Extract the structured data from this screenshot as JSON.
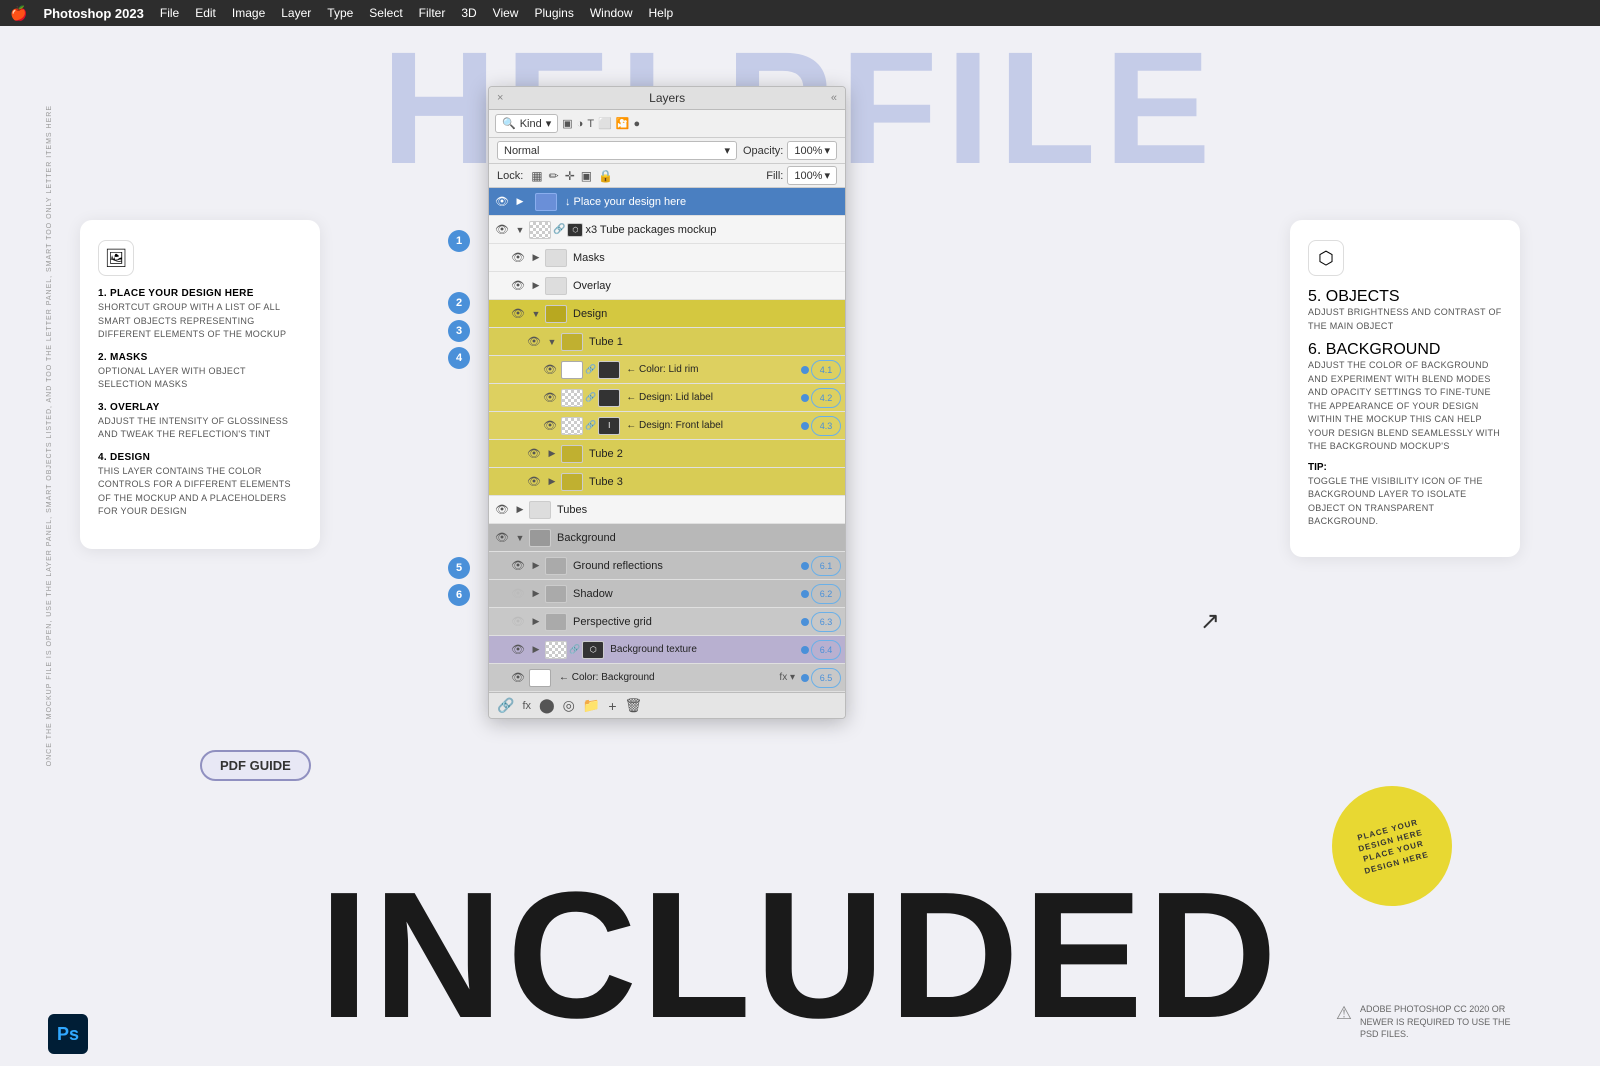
{
  "app": {
    "name": "Photoshop 2023",
    "apple_icon": "🍎",
    "menus": [
      "File",
      "Edit",
      "Image",
      "Layer",
      "Type",
      "Select",
      "Filter",
      "3D",
      "View",
      "Plugins",
      "Window",
      "Help"
    ]
  },
  "bg_text": {
    "top": "HELPFILE",
    "bottom": "INCLUDED"
  },
  "left_card": {
    "icon": "🖼",
    "sections": [
      {
        "num": "1.",
        "title": "PLACE YOUR DESIGN HERE",
        "desc": "SHORTCUT GROUP WITH A LIST OF ALL SMART OBJECTS REPRESENTING DIFFERENT ELEMENTS OF THE MOCKUP"
      },
      {
        "num": "2.",
        "title": "MASKS",
        "desc": "OPTIONAL LAYER WITH OBJECT SELECTION MASKS"
      },
      {
        "num": "3.",
        "title": "OVERLAY",
        "desc": "ADJUST THE INTENSITY OF GLOSSINESS AND TWEAK THE REFLECTION'S TINT"
      },
      {
        "num": "4.",
        "title": "DESIGN",
        "desc": "THIS LAYER CONTAINS THE COLOR CONTROLS FOR A DIFFERENT ELEMENTS OF THE MOCKUP AND A PLACEHOLDERS FOR YOUR DESIGN"
      }
    ]
  },
  "right_card": {
    "icon": "⬡",
    "sections": [
      {
        "num": "5.",
        "title": "OBJECTS",
        "desc": "ADJUST BRIGHTNESS AND CONTRAST OF THE MAIN OBJECT"
      },
      {
        "num": "6.",
        "title": "BACKGROUND",
        "desc": "ADJUST THE COLOR OF BACKGROUND AND EXPERIMENT WITH BLEND MODES AND OPACITY SETTINGS TO FINE-TUNE THE APPEARANCE OF YOUR DESIGN WITHIN THE MOCKUP THIS CAN HELP YOUR DESIGN BLEND SEAMLESSLY WITH THE BACKGROUND MOCKUP'S"
      },
      {
        "tip_label": "TIP:",
        "tip": "TOGGLE THE VISIBILITY ICON OF THE BACKGROUND LAYER TO ISOLATE OBJECT ON TRANSPARENT BACKGROUND."
      }
    ]
  },
  "layers_panel": {
    "title": "Layers",
    "close": "×",
    "collapse": "«",
    "filter": {
      "kind_label": "Kind",
      "icons": [
        "img",
        "adj",
        "T",
        "shape",
        "smart",
        "dot"
      ]
    },
    "blend_mode": "Normal",
    "opacity_label": "Opacity:",
    "opacity_value": "100%",
    "lock_label": "Lock:",
    "fill_label": "Fill:",
    "fill_value": "100%",
    "rows": [
      {
        "id": "r1",
        "level": 0,
        "eye": true,
        "arrow": "▶",
        "type": "folder",
        "label": "↓ Place your design here",
        "badge": "",
        "num_indicator": "1",
        "bg": "blue_header"
      },
      {
        "id": "r2",
        "level": 0,
        "eye": true,
        "arrow": "▼",
        "type": "folder",
        "thumb": "checker",
        "chain": true,
        "smart_icon": true,
        "label": "x3 Tube packages mockup",
        "badge": "",
        "num_indicator": ""
      },
      {
        "id": "r3",
        "level": 1,
        "eye": true,
        "arrow": "▶",
        "type": "folder",
        "label": "Masks",
        "badge": "",
        "num_indicator": "2"
      },
      {
        "id": "r4",
        "level": 1,
        "eye": true,
        "arrow": "▶",
        "type": "folder",
        "label": "Overlay",
        "badge": "",
        "num_indicator": "3"
      },
      {
        "id": "r5",
        "level": 1,
        "eye": true,
        "arrow": "▼",
        "type": "folder",
        "label": "Design",
        "badge": "",
        "num_indicator": "4",
        "bg": "yellow"
      },
      {
        "id": "r6",
        "level": 2,
        "eye": true,
        "arrow": "▼",
        "type": "folder",
        "label": "Tube 1",
        "badge": "",
        "bg": "yellow"
      },
      {
        "id": "r7",
        "level": 3,
        "eye": true,
        "arrow": "",
        "type": "layer",
        "thumb": "black",
        "chain": true,
        "thumb2": "black",
        "label": "← Color: Lid rim",
        "dot": true,
        "badge": "4.1",
        "bg": "yellow"
      },
      {
        "id": "r8",
        "level": 3,
        "eye": true,
        "arrow": "",
        "type": "layer",
        "thumb": "checker",
        "chain": true,
        "thumb2": "black",
        "label": "← Design: Lid label",
        "dot": true,
        "badge": "4.2",
        "bg": "yellow"
      },
      {
        "id": "r9",
        "level": 3,
        "eye": true,
        "arrow": "",
        "type": "layer",
        "thumb": "checker",
        "chain": true,
        "thumb2": "black",
        "label": "← Design: Front label",
        "dot": true,
        "badge": "4.3",
        "bg": "yellow"
      },
      {
        "id": "r10",
        "level": 2,
        "eye": true,
        "arrow": "▶",
        "type": "folder",
        "label": "Tube 2",
        "badge": "",
        "bg": "yellow"
      },
      {
        "id": "r11",
        "level": 2,
        "eye": true,
        "arrow": "▶",
        "type": "folder",
        "label": "Tube 3",
        "badge": "",
        "bg": "yellow"
      },
      {
        "id": "r12",
        "level": 0,
        "eye": true,
        "arrow": "▶",
        "type": "folder",
        "label": "Tubes",
        "badge": "",
        "num_indicator": "5"
      },
      {
        "id": "r13",
        "level": 0,
        "eye": true,
        "arrow": "▼",
        "type": "folder",
        "label": "Background",
        "badge": "",
        "num_indicator": "6",
        "bg": "gray"
      },
      {
        "id": "r14",
        "level": 1,
        "eye": true,
        "arrow": "▶",
        "type": "folder",
        "label": "Ground reflections",
        "dot": true,
        "badge": "6.1",
        "bg": "gray"
      },
      {
        "id": "r15",
        "level": 1,
        "eye": false,
        "arrow": "▶",
        "type": "folder",
        "label": "Shadow",
        "dot": true,
        "badge": "6.2",
        "bg": "gray"
      },
      {
        "id": "r16",
        "level": 1,
        "eye": false,
        "arrow": "▶",
        "type": "folder",
        "label": "Perspective grid",
        "dot": true,
        "badge": "6.3",
        "bg": "gray"
      },
      {
        "id": "r17",
        "level": 1,
        "eye": true,
        "arrow": "▶",
        "type": "folder",
        "thumb": "checker",
        "chain": true,
        "smart_icon": true,
        "label": "Background texture",
        "dot": true,
        "badge": "6.4",
        "bg": "purple"
      },
      {
        "id": "r18",
        "level": 1,
        "eye": true,
        "arrow": "",
        "type": "layer",
        "thumb": "white",
        "label": "← Color: Background",
        "fx": "fx ▾",
        "dot": true,
        "badge": "6.5",
        "bg": "gray"
      }
    ],
    "toolbar_icons": [
      "🔗",
      "fx",
      "⬤",
      "◎",
      "📁",
      "+",
      "🗑"
    ]
  },
  "pdf_button": "PDF GUIDE",
  "ps_label": "Ps",
  "yellow_circle_text": "PLACE YOUR DESIGN HERE\nPLACE YOUR DESIGN HERE",
  "warning_text": "ADOBE PHOTOSHOP CC 2020 OR NEWER IS REQUIRED TO USE THE PSD FILES.",
  "side_text": "ONCE THE MOCKUP FILE IS OPEN, USE THE LAYER PANEL, SMART OBJECTS LISTED, AND TOO THE LETTER PANEL, SMART TOO ONLY LETTER ITEMS HERE"
}
